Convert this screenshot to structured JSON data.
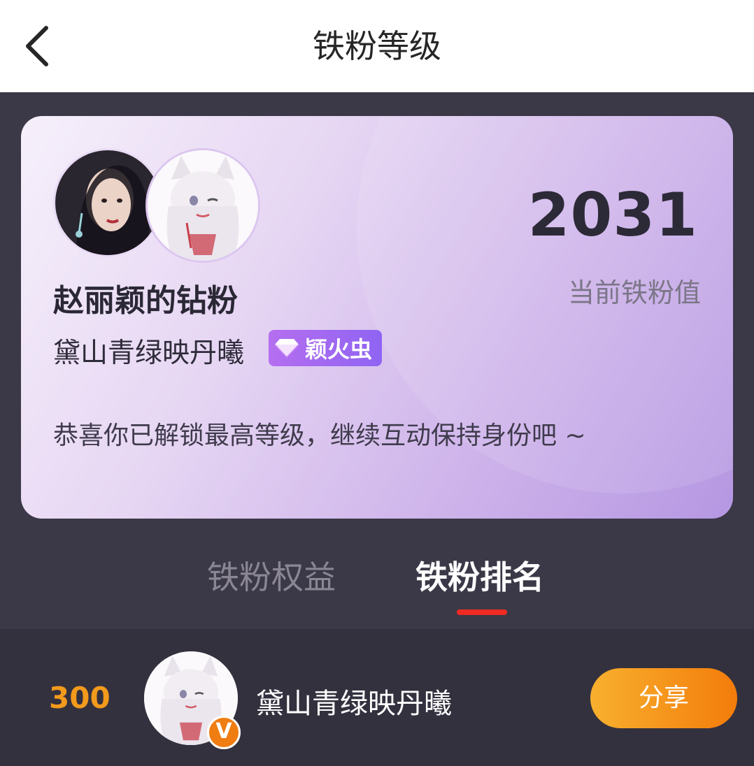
{
  "header": {
    "title": "铁粉等级",
    "back_icon": "chevron-left-icon"
  },
  "card": {
    "score": "2031",
    "score_label": "当前铁粉值",
    "fan_title": "赵丽颖的钻粉",
    "user_name": "黛山青绿映丹曦",
    "badge_label": "颖火虫",
    "badge_icon": "diamond-icon",
    "congrats": "恭喜你已解锁最高等级，继续互动保持身份吧 ~",
    "gradient_colors": [
      "#f6f0fb",
      "#cdb2ea",
      "#b597e2"
    ]
  },
  "tabs": [
    {
      "label": "铁粉权益",
      "active": false
    },
    {
      "label": "铁粉排名",
      "active": true
    }
  ],
  "rank_row": {
    "rank": "300",
    "name": "黛山青绿映丹曦",
    "verified_badge": "V",
    "share_label": "分享"
  },
  "colors": {
    "accent_orange": "#f29a1c",
    "underline_red": "#ef2b23",
    "background": "#3b3847"
  }
}
